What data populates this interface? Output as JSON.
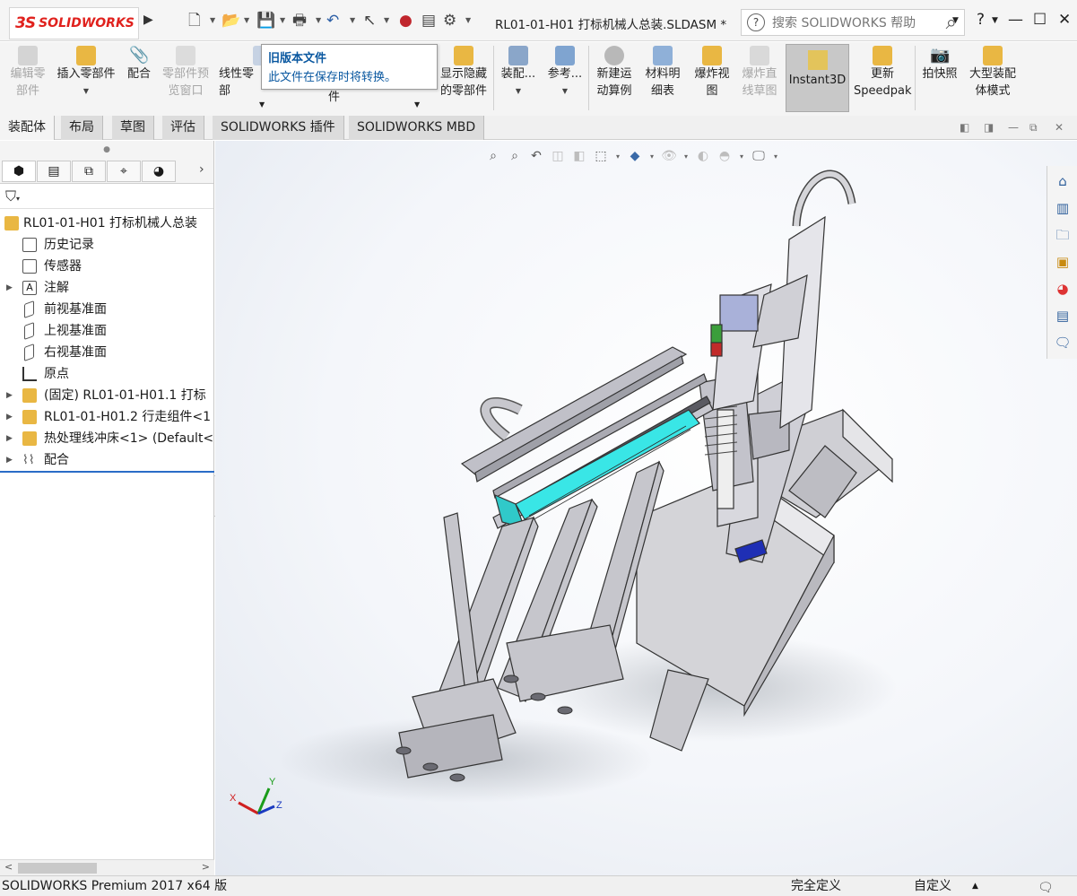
{
  "app": {
    "logo_text": "SOLIDWORKS",
    "logo_mark": "3S",
    "document_title": "RL01-01-H01 打标机械人总装.SLDASM *",
    "search_placeholder": "搜索 SOLIDWORKS 帮助",
    "help_label": "?",
    "window_controls": [
      "—",
      "☐",
      "✕"
    ]
  },
  "tooltip": {
    "title": "旧版本文件",
    "body": "此文件在保存时将转换。"
  },
  "ribbon": {
    "edit_part": "编辑零\n部件",
    "insert_component": "插入零部件",
    "mate": "配合",
    "preview_window": "零部件预\n览窗口",
    "linear_pattern": "线性零部",
    "linear_pattern_line2": "件",
    "show_hidden": "显示隐藏\n的零部件",
    "assembly": "装配...",
    "reference": "参考...",
    "motion_study": "新建运\n动算例",
    "bom": "材料明\n细表",
    "exploded_view": "爆炸视\n图",
    "explode_sketch": "爆炸直\n线草图",
    "instant3d": "Instant3D",
    "update_speedpak": "更新\nSpeedpak",
    "snapshot": "拍快照",
    "large_assembly": "大型装配\n体模式"
  },
  "tabs": [
    "装配体",
    "布局",
    "草图",
    "评估",
    "SOLIDWORKS 插件",
    "SOLIDWORKS MBD"
  ],
  "tree": {
    "root": "RL01-01-H01 打标机械人总装",
    "items": [
      {
        "label": "历史记录",
        "expandable": false
      },
      {
        "label": "传感器",
        "expandable": false
      },
      {
        "label": "注解",
        "expandable": true
      },
      {
        "label": "前视基准面",
        "expandable": false
      },
      {
        "label": "上视基准面",
        "expandable": false
      },
      {
        "label": "右视基准面",
        "expandable": false
      },
      {
        "label": "原点",
        "expandable": false
      },
      {
        "label": "(固定) RL01-01-H01.1 打标",
        "expandable": true
      },
      {
        "label": "RL01-01-H01.2 行走组件<1",
        "expandable": true
      },
      {
        "label": "热处理线冲床<1> (Default<",
        "expandable": true
      },
      {
        "label": "配合",
        "expandable": true
      }
    ]
  },
  "triad": {
    "x": "X",
    "y": "Y",
    "z": "Z"
  },
  "status": {
    "app_version": "SOLIDWORKS Premium 2017 x64 版",
    "definition": "完全定义",
    "custom": "自定义"
  },
  "colors": {
    "brand_red": "#e0211d",
    "tooltip_blue": "#0a58a0",
    "accent_cyan": "#39e6e6",
    "tree_divider": "#2a6cc7"
  }
}
